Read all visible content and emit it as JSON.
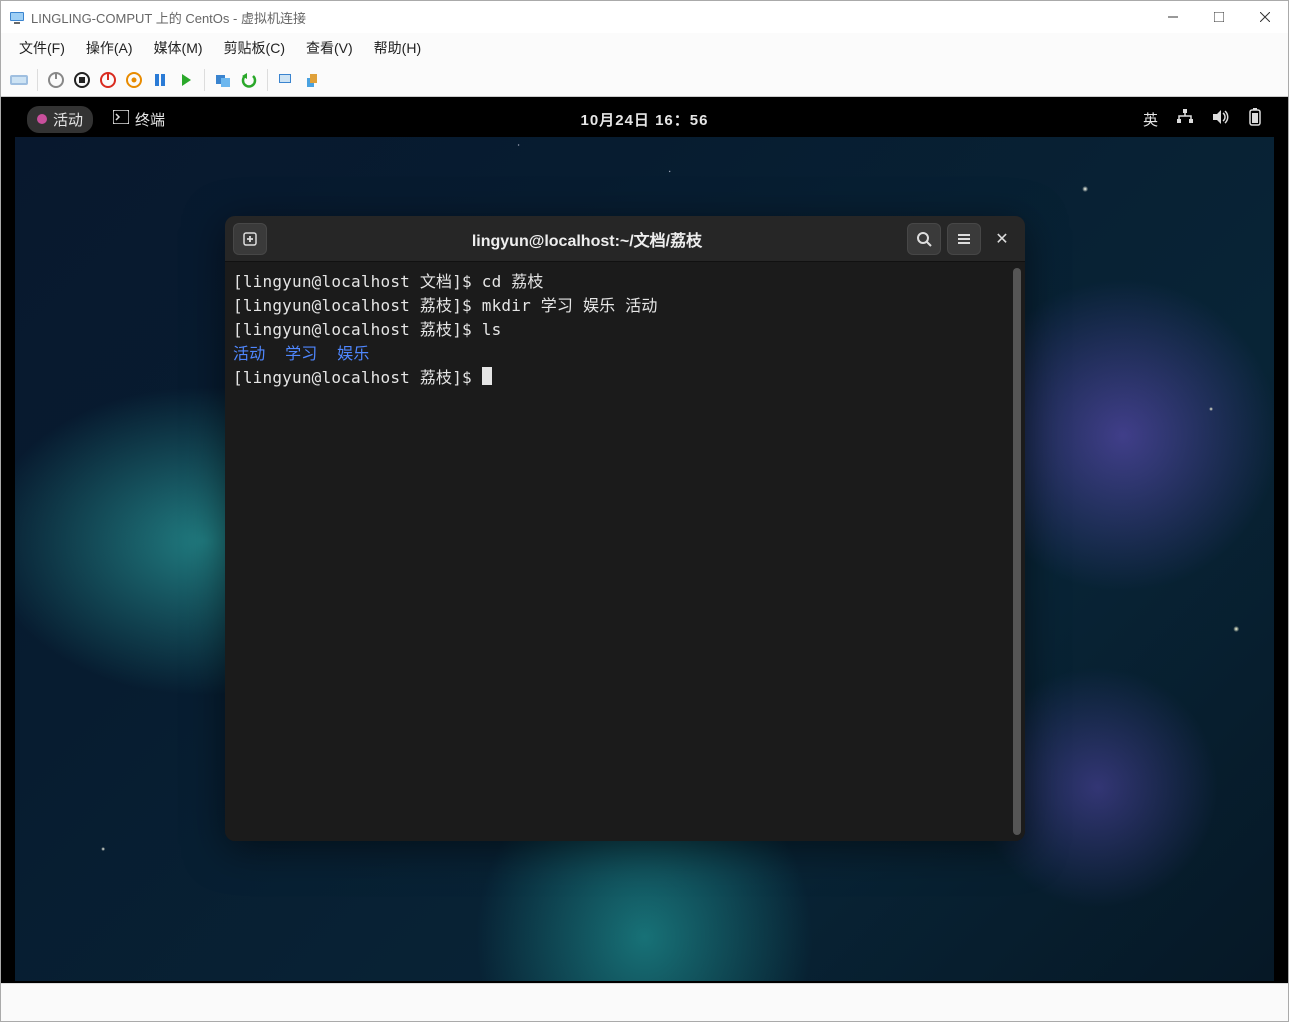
{
  "host": {
    "title": "LINGLING-COMPUT 上的 CentOs - 虚拟机连接",
    "menu": [
      "文件(F)",
      "操作(A)",
      "媒体(M)",
      "剪贴板(C)",
      "查看(V)",
      "帮助(H)"
    ]
  },
  "gnome": {
    "activities": "活动",
    "app_label": "终端",
    "clock": "10月24日 16：56",
    "input_method": "英"
  },
  "terminal": {
    "title": "lingyun@localhost:~/文档/荔枝",
    "lines": [
      {
        "prompt": "[lingyun@localhost 文档]$ ",
        "cmd": "cd 荔枝"
      },
      {
        "prompt": "[lingyun@localhost 荔枝]$ ",
        "cmd": "mkdir 学习 娱乐 活动"
      },
      {
        "prompt": "[lingyun@localhost 荔枝]$ ",
        "cmd": "ls"
      }
    ],
    "ls_output": [
      "活动",
      "学习",
      "娱乐"
    ],
    "current_prompt": "[lingyun@localhost 荔枝]$ "
  },
  "colors": {
    "dir_blue": "#4f87ff",
    "term_bg": "#1b1b1b",
    "term_fg": "#e5e5e5"
  }
}
